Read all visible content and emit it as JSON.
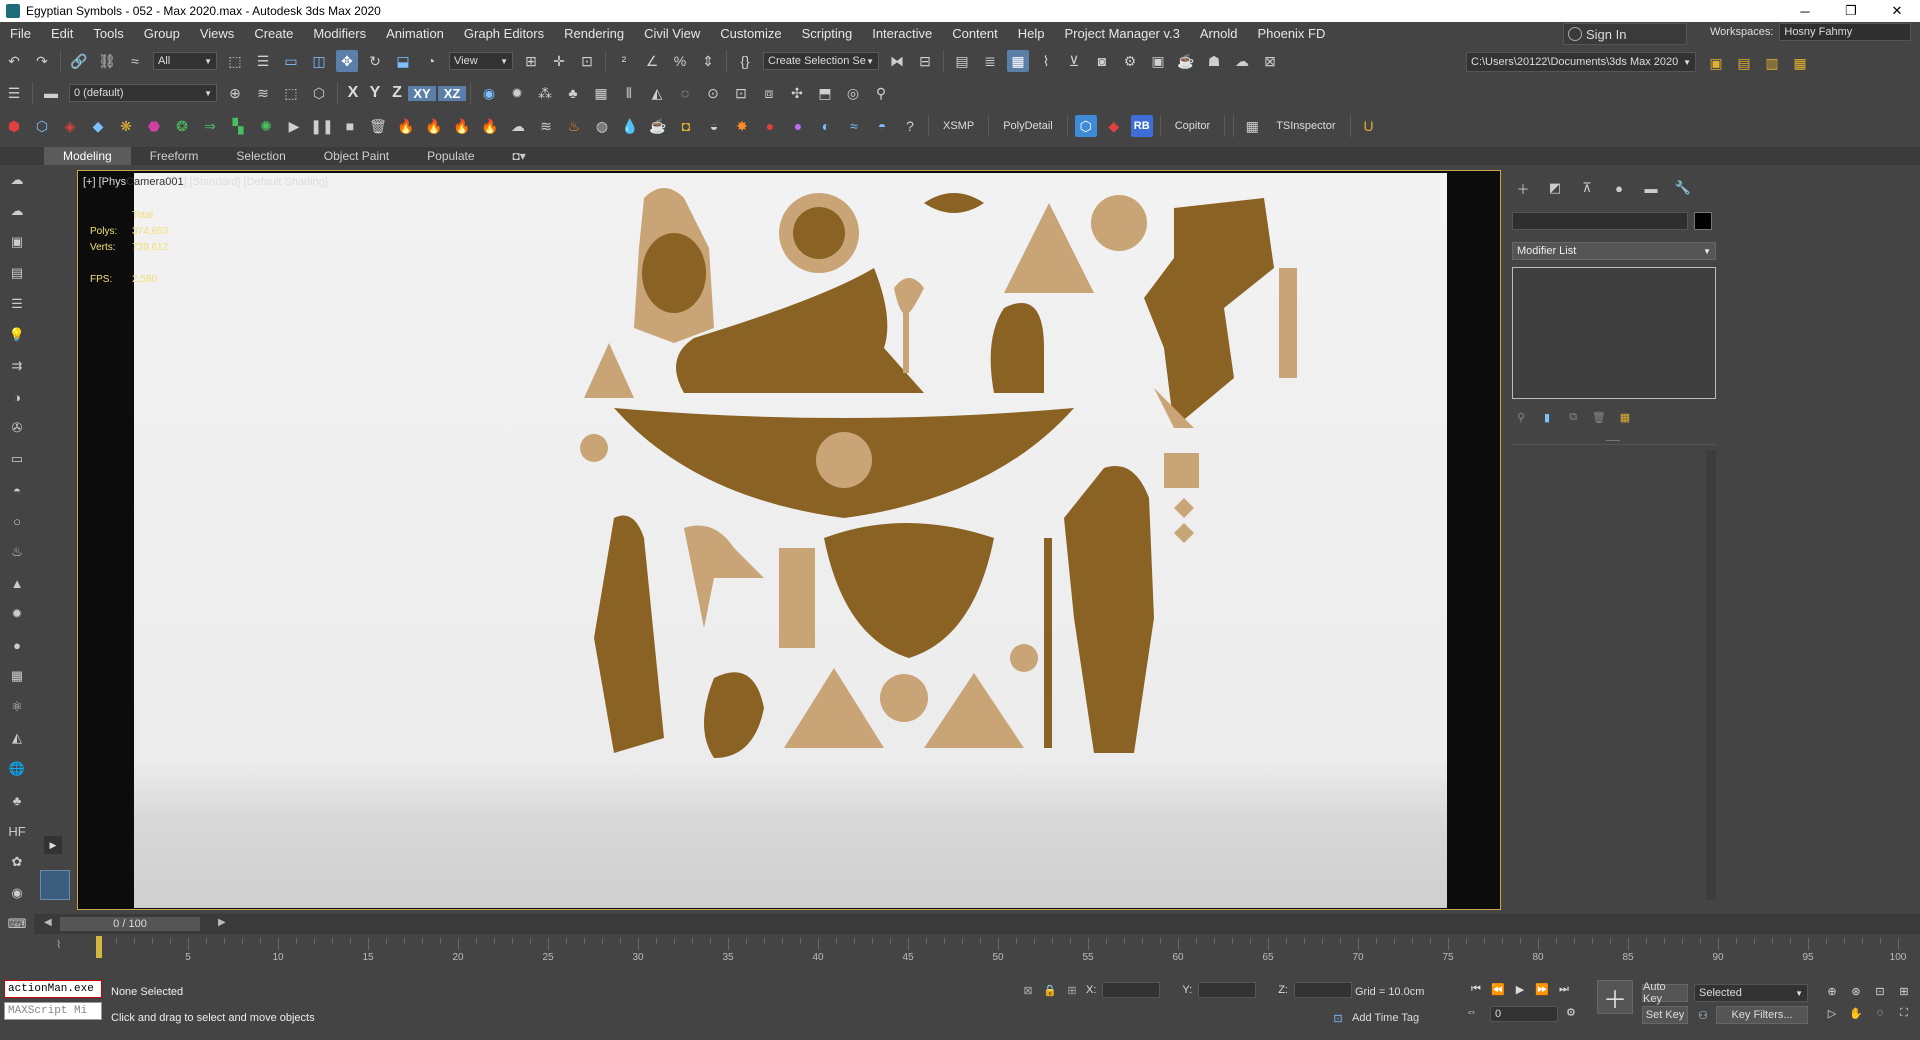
{
  "window": {
    "title": "Egyptian Symbols - 052 - Max 2020.max - Autodesk 3ds Max 2020",
    "controls": [
      "─",
      "❐",
      "✕"
    ]
  },
  "menu": [
    "File",
    "Edit",
    "Tools",
    "Group",
    "Views",
    "Create",
    "Modifiers",
    "Animation",
    "Graph Editors",
    "Rendering",
    "Civil View",
    "Customize",
    "Scripting",
    "Interactive",
    "Content",
    "Help",
    "Project Manager v.3",
    "Arnold",
    "Phoenix FD"
  ],
  "signin": {
    "label": "Sign In"
  },
  "workspaces": {
    "label": "Workspaces:",
    "value": "Hosny Fahmy"
  },
  "toolbar": {
    "selection_filter": "All",
    "ref_coord": "View",
    "named_selection": "Create Selection Se",
    "project_path": "C:\\Users\\20122\\Documents\\3ds Max 2020",
    "layer": "0 (default)",
    "axes": [
      "X",
      "Y",
      "Z",
      "XY",
      "XZ"
    ],
    "plugins": [
      "XSMP",
      "PolyDetail",
      "RB",
      "Copitor",
      "TSInspector"
    ]
  },
  "ribbon": {
    "tabs": [
      "Modeling",
      "Freeform",
      "Selection",
      "Object Paint",
      "Populate"
    ],
    "active": "Modeling"
  },
  "viewport": {
    "label_prefix": "[+] [Phys",
    "label_camera": "Camera001",
    "label_suffix": "] [Standard] [Default Shading]",
    "stats": {
      "total_label": "Total",
      "polys_label": "Polys:",
      "polys": "374,653",
      "verts_label": "Verts:",
      "verts": "739,612",
      "fps_label": "FPS:",
      "fps": "2.580"
    }
  },
  "command_panel": {
    "modifier_list": "Modifier List"
  },
  "timeline": {
    "frame_indicator": "0 / 100",
    "ticks": [
      "5",
      "10",
      "15",
      "20",
      "25",
      "30",
      "35",
      "40",
      "45",
      "50",
      "55",
      "60",
      "65",
      "70",
      "75",
      "80",
      "85",
      "90",
      "95",
      "100"
    ]
  },
  "status": {
    "maxscript_line": "actionMan.exe",
    "maxscript_listener": "MAXScript Mi",
    "selection": "None Selected",
    "prompt": "Click and drag to select and move objects",
    "x_label": "X:",
    "y_label": "Y:",
    "z_label": "Z:",
    "grid": "Grid = 10.0cm",
    "add_time_tag": "Add Time Tag",
    "auto_key": "Auto Key",
    "set_key": "Set Key",
    "key_set": "Selected",
    "key_filters": "Key Filters...",
    "current_frame": "0"
  },
  "colors": {
    "art_gold": "#8a6223",
    "art_light": "#c9a476",
    "viewport_border": "#c8a84a",
    "stats_text": "#f0e078"
  }
}
